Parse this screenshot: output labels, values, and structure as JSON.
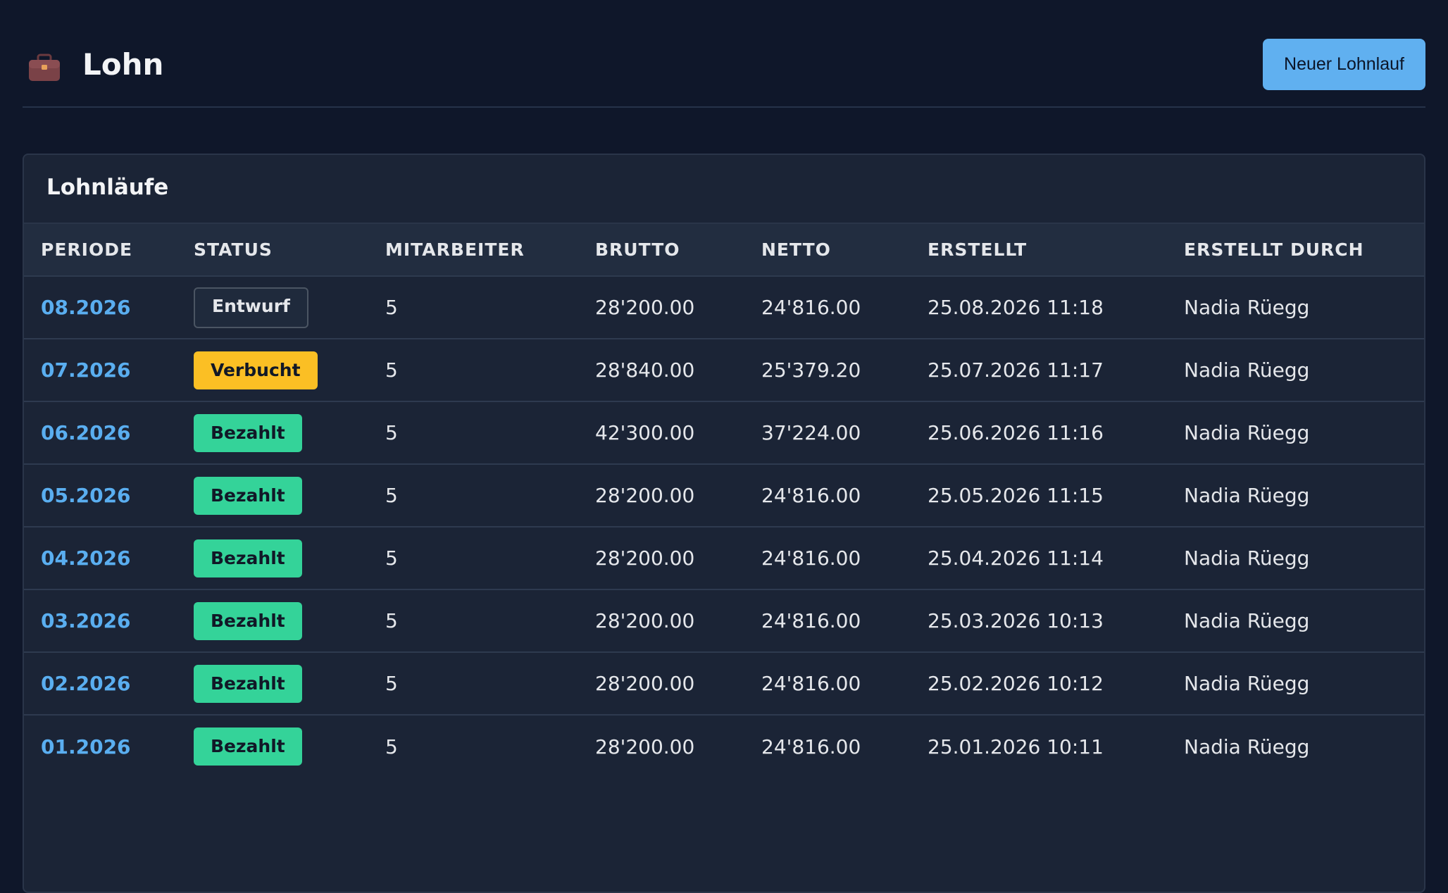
{
  "page": {
    "title": "Lohn",
    "icon": "briefcase-icon"
  },
  "toolbar": {
    "new_run_label": "Neuer Lohnlauf"
  },
  "colors": {
    "background": "#0f172a",
    "card": "#1b2436",
    "accent": "#60b0f0",
    "link": "#5aaef0",
    "status_draft": "#1f2a3c",
    "status_booked": "#fbbf24",
    "status_paid": "#34d399"
  },
  "card": {
    "title": "Lohnläufe"
  },
  "table": {
    "columns": [
      "PERIODE",
      "STATUS",
      "MITARBEITER",
      "BRUTTO",
      "NETTO",
      "ERSTELLT",
      "ERSTELLT DURCH"
    ],
    "rows": [
      {
        "period": "08.2026",
        "status": "Entwurf",
        "status_type": "draft",
        "employees": "5",
        "gross": "28'200.00",
        "net": "24'816.00",
        "created": "25.08.2026 11:18",
        "created_by": "Nadia Rüegg"
      },
      {
        "period": "07.2026",
        "status": "Verbucht",
        "status_type": "booked",
        "employees": "5",
        "gross": "28'840.00",
        "net": "25'379.20",
        "created": "25.07.2026 11:17",
        "created_by": "Nadia Rüegg"
      },
      {
        "period": "06.2026",
        "status": "Bezahlt",
        "status_type": "paid",
        "employees": "5",
        "gross": "42'300.00",
        "net": "37'224.00",
        "created": "25.06.2026 11:16",
        "created_by": "Nadia Rüegg"
      },
      {
        "period": "05.2026",
        "status": "Bezahlt",
        "status_type": "paid",
        "employees": "5",
        "gross": "28'200.00",
        "net": "24'816.00",
        "created": "25.05.2026 11:15",
        "created_by": "Nadia Rüegg"
      },
      {
        "period": "04.2026",
        "status": "Bezahlt",
        "status_type": "paid",
        "employees": "5",
        "gross": "28'200.00",
        "net": "24'816.00",
        "created": "25.04.2026 11:14",
        "created_by": "Nadia Rüegg"
      },
      {
        "period": "03.2026",
        "status": "Bezahlt",
        "status_type": "paid",
        "employees": "5",
        "gross": "28'200.00",
        "net": "24'816.00",
        "created": "25.03.2026 10:13",
        "created_by": "Nadia Rüegg"
      },
      {
        "period": "02.2026",
        "status": "Bezahlt",
        "status_type": "paid",
        "employees": "5",
        "gross": "28'200.00",
        "net": "24'816.00",
        "created": "25.02.2026 10:12",
        "created_by": "Nadia Rüegg"
      },
      {
        "period": "01.2026",
        "status": "Bezahlt",
        "status_type": "paid",
        "employees": "5",
        "gross": "28'200.00",
        "net": "24'816.00",
        "created": "25.01.2026 10:11",
        "created_by": "Nadia Rüegg"
      }
    ]
  }
}
